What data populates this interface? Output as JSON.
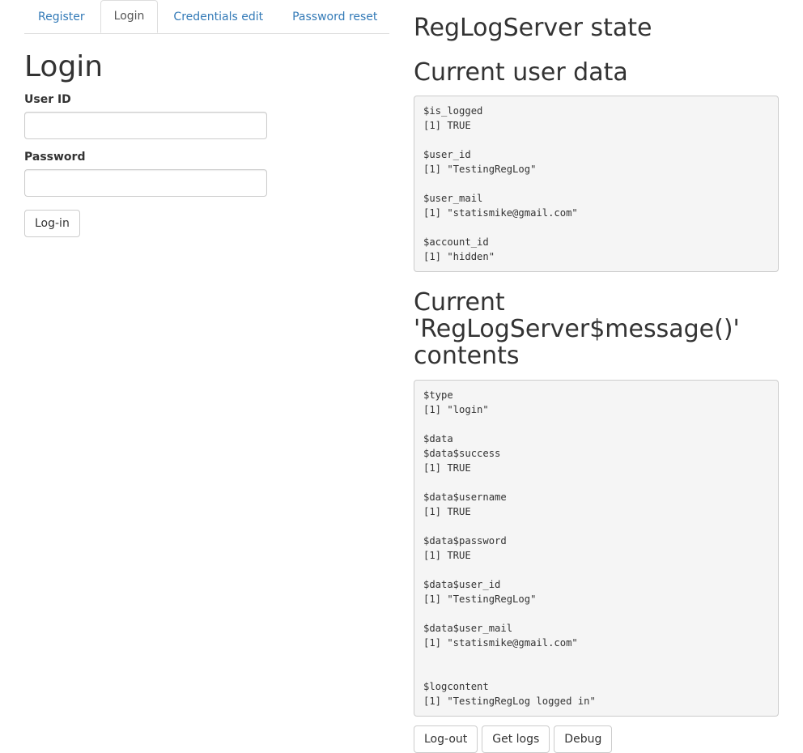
{
  "tabs": [
    {
      "label": "Register",
      "active": false
    },
    {
      "label": "Login",
      "active": true
    },
    {
      "label": "Credentials edit",
      "active": false
    },
    {
      "label": "Password reset",
      "active": false
    }
  ],
  "login": {
    "title": "Login",
    "user_id_label": "User ID",
    "user_id_value": "",
    "password_label": "Password",
    "password_value": "",
    "button_label": "Log-in"
  },
  "state": {
    "title": "RegLogServer state",
    "user_data_title": "Current user data",
    "user_data": "$is_logged\n[1] TRUE\n\n$user_id\n[1] \"TestingRegLog\"\n\n$user_mail\n[1] \"statismike@gmail.com\"\n\n$account_id\n[1] \"hidden\"",
    "message_title": "Current 'RegLogServer$message()' contents",
    "message_content": "$type\n[1] \"login\"\n\n$data\n$data$success\n[1] TRUE\n\n$data$username\n[1] TRUE\n\n$data$password\n[1] TRUE\n\n$data$user_id\n[1] \"TestingRegLog\"\n\n$data$user_mail\n[1] \"statismike@gmail.com\"\n\n\n$logcontent\n[1] \"TestingRegLog logged in\"",
    "buttons": {
      "logout": "Log-out",
      "get_logs": "Get logs",
      "debug": "Debug"
    }
  },
  "colors": {
    "link": "#337ab7",
    "text": "#333333",
    "border": "#dddddd",
    "pre_bg": "#f5f5f5"
  }
}
